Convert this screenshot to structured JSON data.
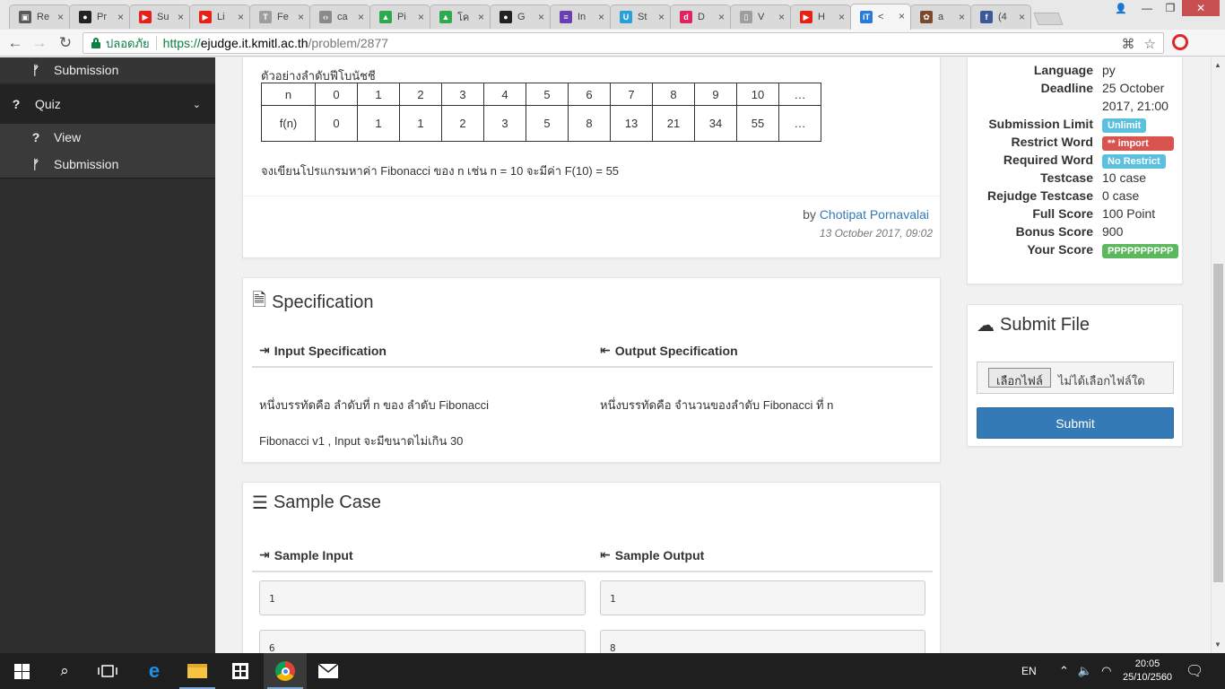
{
  "browser": {
    "tabs": [
      {
        "title": "Re",
        "color": "#5a5a5a",
        "glyph": "▣"
      },
      {
        "title": "Pr",
        "color": "#222222",
        "glyph": "●"
      },
      {
        "title": "Su",
        "color": "#e62117",
        "glyph": "▶"
      },
      {
        "title": "Li",
        "color": "#e62117",
        "glyph": "▶"
      },
      {
        "title": "Fe",
        "color": "#9e9e9e",
        "glyph": "T"
      },
      {
        "title": "ca",
        "color": "#8a8a8a",
        "glyph": "‹›"
      },
      {
        "title": "Pi",
        "color": "#2da94f",
        "glyph": "▲"
      },
      {
        "title": "โค",
        "color": "#2da94f",
        "glyph": "▲"
      },
      {
        "title": "G",
        "color": "#222222",
        "glyph": "●"
      },
      {
        "title": "In",
        "color": "#6a3fb5",
        "glyph": "≡"
      },
      {
        "title": "St",
        "color": "#2aa0d8",
        "glyph": "U"
      },
      {
        "title": "D",
        "color": "#e0245e",
        "glyph": "d"
      },
      {
        "title": "V",
        "color": "#9e9e9e",
        "glyph": "▯"
      },
      {
        "title": "H",
        "color": "#e62117",
        "glyph": "▶"
      },
      {
        "title": "<",
        "color": "#2a7bd8",
        "glyph": "iT"
      },
      {
        "title": "a",
        "color": "#7a4a2a",
        "glyph": "✿"
      },
      {
        "title": "(4",
        "color": "#3b5998",
        "glyph": "f"
      }
    ],
    "active_tab_index": 14,
    "secure_label": "ปลอดภัย",
    "url_scheme": "https://",
    "url_host": "ejudge.it.kmitl.ac.th",
    "url_path": "/problem/2877"
  },
  "sidebar": {
    "submission_top": "Submission",
    "quiz_label": "Quiz",
    "view_label": "View",
    "submission_label": "Submission"
  },
  "problem": {
    "table_caption": "ตัวอย่างลำดับฟีโบนัชชี",
    "row1_header": "n",
    "row1": [
      "0",
      "1",
      "2",
      "3",
      "4",
      "5",
      "6",
      "7",
      "8",
      "9",
      "10",
      "…"
    ],
    "row2_header": "f(n)",
    "row2": [
      "0",
      "1",
      "1",
      "2",
      "3",
      "5",
      "8",
      "13",
      "21",
      "34",
      "55",
      "…"
    ],
    "task_text": "จงเขียนโปรแกรมหาค่า Fibonacci ของ n เช่น n = 10 จะมีค่า F(10) = 55",
    "by_label": "by",
    "author": "Chotipat Pornavalai",
    "posted": "13 October 2017, 09:02"
  },
  "specification": {
    "title": "Specification",
    "input_title": "Input Specification",
    "output_title": "Output Specification",
    "input_line1": "หนึ่งบรรทัดคือ ลำดับที่ n ของ ลำดับ Fibonacci",
    "input_line2": "Fibonacci v1 , Input จะมีขนาดไม่เกิน 30",
    "output_line1": "หนึ่งบรรทัดคือ จำนวนของลำดับ Fibonacci ที่ n"
  },
  "sample": {
    "title": "Sample Case",
    "input_title": "Sample Input",
    "output_title": "Sample Output",
    "inputs": [
      "1",
      "6"
    ],
    "outputs": [
      "1",
      "8"
    ]
  },
  "info": {
    "language_k": "Language",
    "language_v": "py",
    "deadline_k": "Deadline",
    "deadline_v1": "25 October",
    "deadline_v2": "2017, 21:00",
    "sublimit_k": "Submission Limit",
    "sublimit_v": "Unlimit",
    "restrict_k": "Restrict Word",
    "restrict_v": "** import",
    "required_k": "Required Word",
    "required_v": "No Restrict",
    "testcase_k": "Testcase",
    "testcase_v": "10 case",
    "rejudge_k": "Rejudge Testcase",
    "rejudge_v": "0 case",
    "full_k": "Full Score",
    "full_v": "100 Point",
    "bonus_k": "Bonus Score",
    "bonus_v": "900",
    "your_k": "Your Score",
    "your_v": "PPPPPPPPPP",
    "colors": {
      "info": "#5bc0de",
      "danger": "#d9534f",
      "success": "#5cb85c"
    }
  },
  "submit": {
    "title": "Submit File",
    "choose_button": "เลือกไฟล์",
    "no_file": "ไม่ได้เลือกไฟล์ใด",
    "submit_button": "Submit",
    "accent": "#337ab7"
  },
  "taskbar": {
    "lang": "EN",
    "time": "20:05",
    "date": "25/10/2560"
  }
}
